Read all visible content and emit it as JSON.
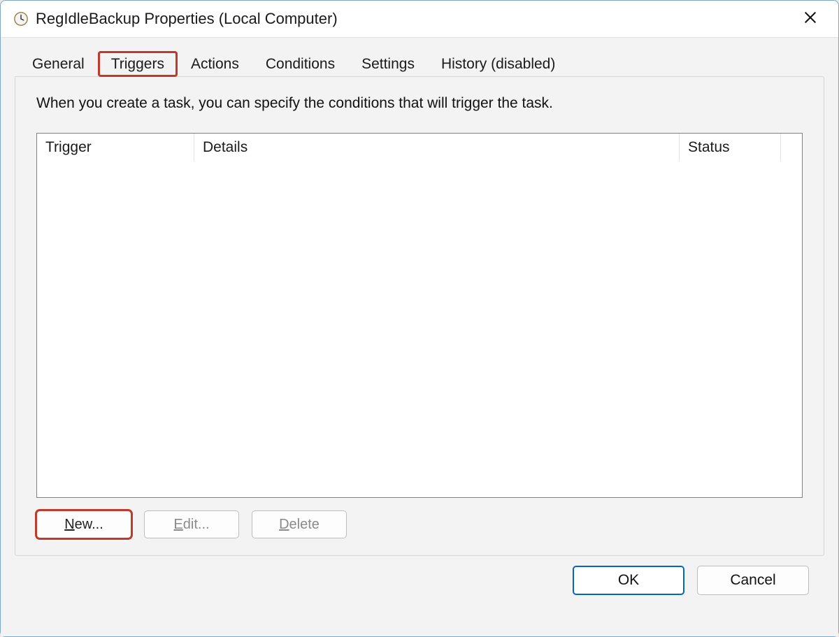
{
  "window": {
    "title": "RegIdleBackup Properties (Local Computer)"
  },
  "tabs": {
    "general": "General",
    "triggers": "Triggers",
    "actions": "Actions",
    "conditions": "Conditions",
    "settings": "Settings",
    "history": "History (disabled)",
    "active": "triggers",
    "highlighted": "triggers"
  },
  "triggers_panel": {
    "description": "When you create a task, you can specify the conditions that will trigger the task.",
    "columns": {
      "trigger": "Trigger",
      "details": "Details",
      "status": "Status"
    },
    "rows": [],
    "buttons": {
      "new": {
        "label": "New...",
        "mnemonic_index": 0,
        "enabled": true,
        "highlighted": true
      },
      "edit": {
        "label": "Edit...",
        "mnemonic_index": 0,
        "enabled": false,
        "highlighted": false
      },
      "delete": {
        "label": "Delete",
        "mnemonic_index": 0,
        "enabled": false,
        "highlighted": false
      }
    }
  },
  "footer": {
    "ok": "OK",
    "cancel": "Cancel"
  },
  "colors": {
    "highlight_border": "#c0392b",
    "primary_border": "#0067c0"
  }
}
